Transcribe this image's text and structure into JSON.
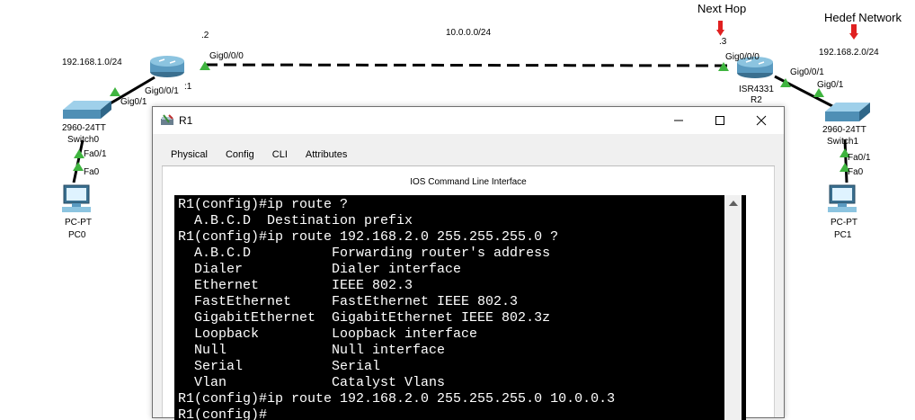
{
  "topology": {
    "annotations": {
      "next_hop": "Next Hop",
      "destination_network": "Hedef Network"
    },
    "networks": {
      "left_lan": "192.168.1.0/24",
      "wan": "10.0.0.0/24",
      "right_lan": "192.168.2.0/24"
    },
    "r1": {
      "wan_ip_suffix": ".2",
      "wan_port": "Gig0/0/0",
      "lan_port": "Gig0/0/1",
      "suffix_label": ":1",
      "name": "R1"
    },
    "r2": {
      "wan_ip_suffix": ".3",
      "wan_port": "Gig0/0/0",
      "lan_port": "Gig0/0/1",
      "model": "ISR4331",
      "name": "R2"
    },
    "switch0": {
      "uplink_port": "Gig0/1",
      "model": "2960-24TT",
      "name": "Switch0",
      "access_port": "Fa0/1"
    },
    "switch1": {
      "uplink_port": "Gig0/1",
      "model": "2960-24TT",
      "name": "Switch1",
      "access_port": "Fa0/1"
    },
    "pc0": {
      "port": "Fa0",
      "model": "PC-PT",
      "name": "PC0"
    },
    "pc1": {
      "port": "Fa0",
      "model": "PC-PT",
      "name": "PC1"
    },
    "colors": {
      "link": "#000000",
      "link_up": "#3fb43f",
      "annotation_marker": "#e02020"
    }
  },
  "window": {
    "title": "R1",
    "tabs": [
      "Physical",
      "Config",
      "CLI",
      "Attributes"
    ],
    "active_tab": "CLI",
    "header": "IOS Command Line Interface",
    "terminal_lines": [
      "R1(config)#ip route ?",
      "  A.B.C.D  Destination prefix",
      "R1(config)#ip route 192.168.2.0 255.255.255.0 ?",
      "  A.B.C.D          Forwarding router's address",
      "  Dialer           Dialer interface",
      "  Ethernet         IEEE 802.3",
      "  FastEthernet     FastEthernet IEEE 802.3",
      "  GigabitEthernet  GigabitEthernet IEEE 802.3z",
      "  Loopback         Loopback interface",
      "  Null             Null interface",
      "  Serial           Serial",
      "  Vlan             Catalyst Vlans",
      "R1(config)#ip route 192.168.2.0 255.255.255.0 10.0.0.3",
      "R1(config)#"
    ]
  }
}
